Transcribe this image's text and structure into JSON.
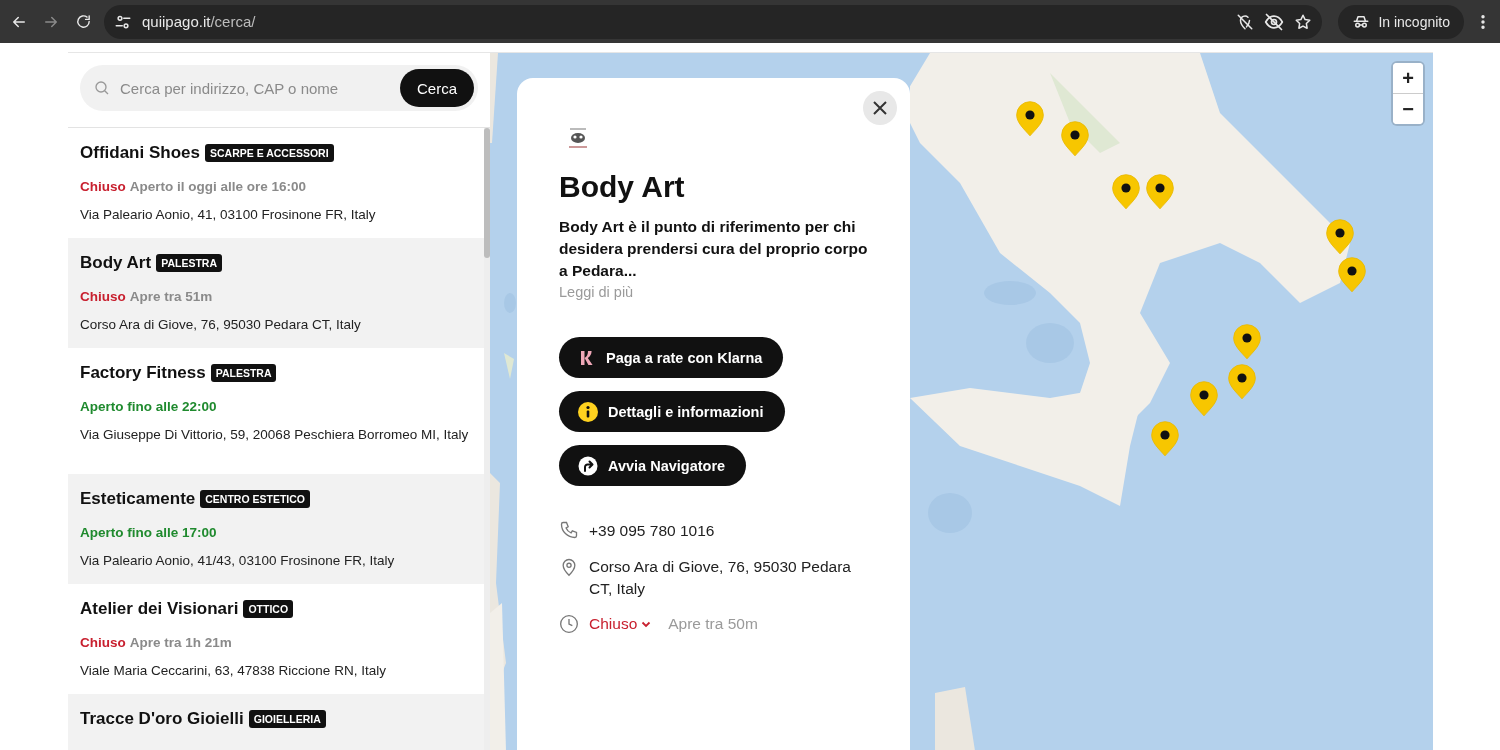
{
  "browser": {
    "url_host": "quiipago.it",
    "url_path": "/cerca/",
    "incognito_label": "In incognito"
  },
  "search": {
    "placeholder": "Cerca per indirizzo, CAP o nome",
    "button": "Cerca"
  },
  "stores": [
    {
      "name": "Offidani Shoes",
      "category": "SCARPE E ACCESSORI",
      "status": {
        "kind": "closed",
        "text": "Chiuso"
      },
      "hours": "Aperto il oggi alle ore 16:00",
      "address": "Via Paleario Aonio, 41, 03100 Frosinone FR, Italy"
    },
    {
      "name": "Body Art",
      "category": "PALESTRA",
      "status": {
        "kind": "closed",
        "text": "Chiuso"
      },
      "hours": "Apre tra 51m",
      "address": "Corso Ara di Giove, 76, 95030 Pedara CT, Italy"
    },
    {
      "name": "Factory Fitness",
      "category": "PALESTRA",
      "status": {
        "kind": "open",
        "text": "Aperto fino alle 22:00"
      },
      "address": "Via Giuseppe Di Vittorio, 59, 20068 Peschiera Borromeo MI, Italy"
    },
    {
      "name": "Esteticamente",
      "category": "CENTRO ESTETICO",
      "status": {
        "kind": "open",
        "text": "Aperto fino alle 17:00"
      },
      "address": "Via Paleario Aonio, 41/43, 03100 Frosinone FR, Italy"
    },
    {
      "name": "Atelier dei Visionari",
      "category": "OTTICO",
      "status": {
        "kind": "closed",
        "text": "Chiuso"
      },
      "hours": "Apre tra 1h 21m",
      "address": "Viale Maria Ceccarini, 63, 47838 Riccione RN, Italy"
    },
    {
      "name": "Tracce D'oro Gioielli",
      "category": "GIOIELLERIA"
    }
  ],
  "detail": {
    "title": "Body Art",
    "description": "Body Art è il punto di riferimento per chi desidera prendersi cura del proprio corpo a Pedara...",
    "read_more": "Leggi di più",
    "actions": [
      {
        "kind": "klarna",
        "label": "Paga a rate con Klarna"
      },
      {
        "kind": "info",
        "label": "Dettagli e informazioni"
      },
      {
        "kind": "navigate",
        "label": "Avvia Navigatore"
      }
    ],
    "phone": "+39 095 780 1016",
    "address": "Corso Ara di Giove, 76, 95030 Pedara CT, Italy",
    "status": {
      "kind": "closed",
      "text": "Chiuso"
    },
    "hours": "Apre tra 50m"
  },
  "map": {
    "kind": "picture",
    "zoom_in": "+",
    "zoom_out": "−"
  }
}
